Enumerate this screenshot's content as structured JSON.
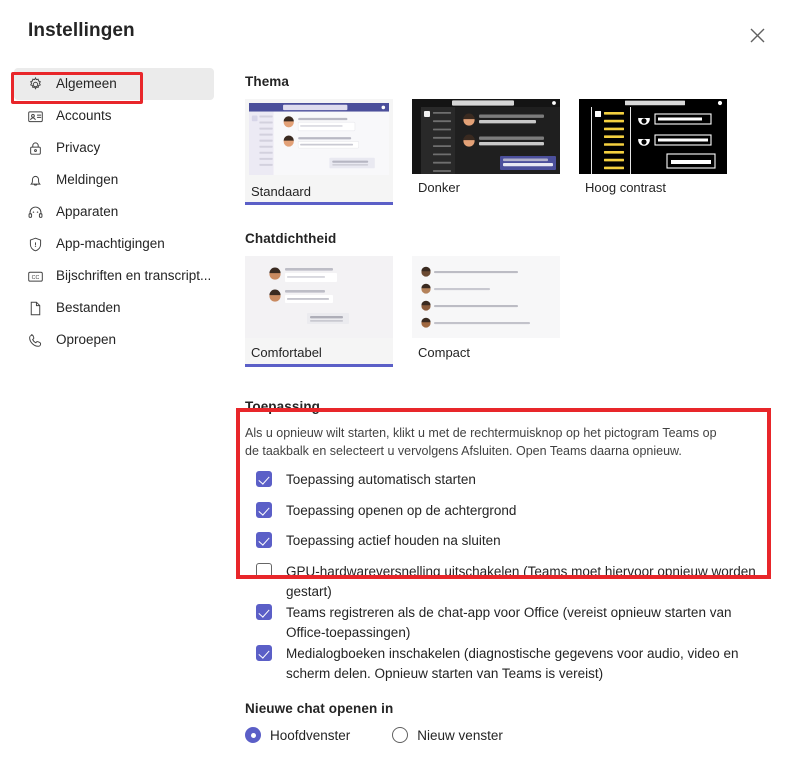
{
  "dialog": {
    "title": "Instellingen",
    "close_icon": "close-icon",
    "close_label": "Sluiten"
  },
  "sidebar": {
    "items": [
      {
        "label": "Algemeen",
        "icon": "gear-icon",
        "selected": true
      },
      {
        "label": "Accounts",
        "icon": "id-card-icon",
        "selected": false
      },
      {
        "label": "Privacy",
        "icon": "lock-icon",
        "selected": false
      },
      {
        "label": "Meldingen",
        "icon": "bell-icon",
        "selected": false
      },
      {
        "label": "Apparaten",
        "icon": "headset-icon",
        "selected": false
      },
      {
        "label": "App-machtigingen",
        "icon": "shield-icon",
        "selected": false
      },
      {
        "label": "Bijschriften en transcript...",
        "icon": "closed-caption-icon",
        "selected": false
      },
      {
        "label": "Bestanden",
        "icon": "file-icon",
        "selected": false
      },
      {
        "label": "Oproepen",
        "icon": "phone-icon",
        "selected": false
      }
    ]
  },
  "theme": {
    "title": "Thema",
    "options": [
      {
        "label": "Standaard",
        "selected": true
      },
      {
        "label": "Donker",
        "selected": false
      },
      {
        "label": "Hoog contrast",
        "selected": false
      }
    ]
  },
  "chat_density": {
    "title": "Chatdichtheid",
    "options": [
      {
        "label": "Comfortabel",
        "selected": true
      },
      {
        "label": "Compact",
        "selected": false
      }
    ]
  },
  "application": {
    "title": "Toepassing",
    "description": "Als u opnieuw wilt starten, klikt u met de rechtermuisknop op het pictogram Teams op de taakbalk en selecteert u vervolgens Afsluiten. Open Teams daarna opnieuw.",
    "checkboxes": [
      {
        "label": "Toepassing automatisch starten",
        "checked": true
      },
      {
        "label": "Toepassing openen op de achtergrond",
        "checked": true
      },
      {
        "label": "Toepassing actief houden na sluiten",
        "checked": true
      },
      {
        "label": "GPU-hardwareversnelling uitschakelen (Teams moet hiervoor opnieuw worden gestart)",
        "checked": false
      },
      {
        "label": "Teams registreren als de chat-app voor Office (vereist opnieuw starten van Office-toepassingen)",
        "checked": true
      },
      {
        "label": "Medialogboeken inschakelen (diagnostische gegevens voor audio, video en scherm delen. Opnieuw starten van Teams is vereist)",
        "checked": true
      }
    ]
  },
  "new_chat": {
    "title": "Nieuwe chat openen in",
    "options": [
      {
        "label": "Hoofdvenster",
        "selected": true
      },
      {
        "label": "Nieuw venster",
        "selected": false
      }
    ]
  },
  "annotations": [
    {
      "name": "sidebar-highlight",
      "color": "#e8262a"
    },
    {
      "name": "application-section-highlight",
      "color": "#e8262a"
    }
  ],
  "colors": {
    "accent": "#5b5fc7",
    "annotation": "#e8262a",
    "selected_nav_bg": "#ebebeb"
  }
}
